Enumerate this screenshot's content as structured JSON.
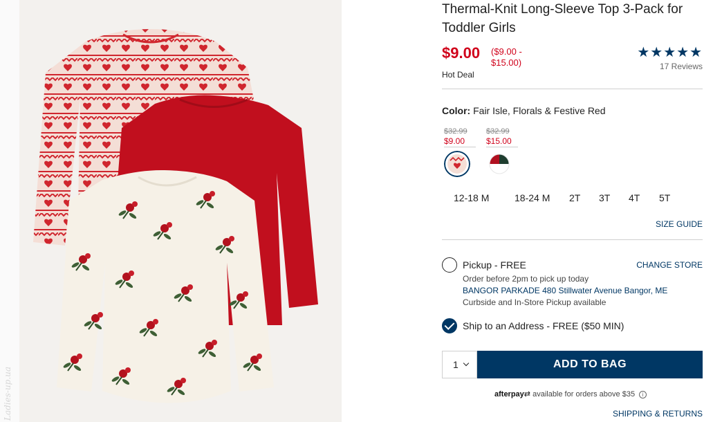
{
  "watermark": "Ladies-up.ua",
  "product": {
    "title": "Thermal-Knit Long-Sleeve Top 3-Pack for Toddler Girls",
    "price": "$9.00",
    "price_range": "($9.00 - $15.00)",
    "deal_label": "Hot Deal",
    "rating_stars": "★★★★★",
    "rating_value": 5,
    "reviews": "17 Reviews"
  },
  "color": {
    "label": "Color:",
    "value": "Fair Isle, Florals & Festive Red",
    "swatches": [
      {
        "original_price": "$32.99",
        "sale_price": "$9.00",
        "selected": true,
        "name": "fair-isle"
      },
      {
        "original_price": "$32.99",
        "sale_price": "$15.00",
        "selected": false,
        "name": "green-red"
      }
    ]
  },
  "sizes": [
    "12-18 M",
    "18-24 M",
    "2T",
    "3T",
    "4T",
    "5T"
  ],
  "size_guide": "SIZE GUIDE",
  "fulfillment": {
    "pickup": {
      "label": "Pickup - FREE",
      "change_store": "CHANGE STORE",
      "order_before": "Order before 2pm to pick up today",
      "store": "BANGOR PARKADE 480 Stillwater Avenue  Bangor, ME",
      "note": "Curbside and In-Store Pickup available",
      "selected": false
    },
    "ship": {
      "label": "Ship to an Address - FREE ($50 MIN)",
      "selected": true
    }
  },
  "cart": {
    "quantity": "1",
    "add_to_bag": "ADD TO BAG"
  },
  "afterpay": {
    "logo": "afterpay",
    "text": "available for orders above $35",
    "info_icon": "i"
  },
  "shipping_returns": "SHIPPING & RETURNS",
  "colors": {
    "navy": "#003764",
    "sale_red": "#d0021b",
    "shirt_red": "#c10f1e",
    "cream": "#f6f1e7"
  }
}
